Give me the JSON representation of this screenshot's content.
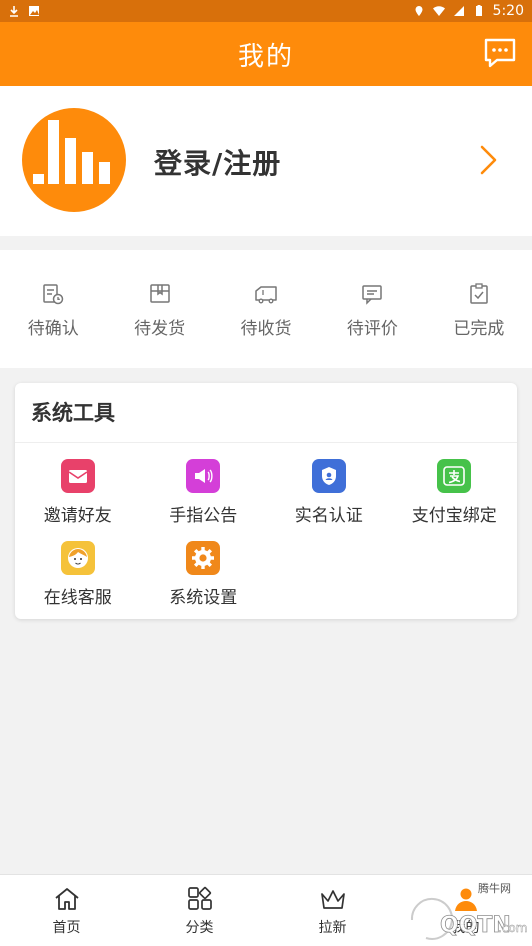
{
  "status_bar": {
    "time": "5:20"
  },
  "header": {
    "title": "我的"
  },
  "profile": {
    "login_label": "登录/注册"
  },
  "orders": [
    {
      "label": "待确认",
      "icon": "pending-confirm-icon"
    },
    {
      "label": "待发货",
      "icon": "pending-ship-icon"
    },
    {
      "label": "待收货",
      "icon": "pending-receive-icon"
    },
    {
      "label": "待评价",
      "icon": "pending-review-icon"
    },
    {
      "label": "已完成",
      "icon": "completed-icon"
    }
  ],
  "tools": {
    "title": "系统工具",
    "items": [
      {
        "label": "邀请好友",
        "icon": "invite-icon",
        "color": "#e8416a"
      },
      {
        "label": "手指公告",
        "icon": "announcement-icon",
        "color": "#d43fd8"
      },
      {
        "label": "实名认证",
        "icon": "verify-icon",
        "color": "#3f6fd8"
      },
      {
        "label": "支付宝绑定",
        "icon": "alipay-icon",
        "color": "#46c24a"
      },
      {
        "label": "在线客服",
        "icon": "customer-service-icon",
        "color": "#f5c23a"
      },
      {
        "label": "系统设置",
        "icon": "settings-icon",
        "color": "#f0881a"
      }
    ]
  },
  "bottom_nav": [
    {
      "label": "首页",
      "icon": "home-icon"
    },
    {
      "label": "分类",
      "icon": "category-icon"
    },
    {
      "label": "拉新",
      "icon": "crown-icon"
    },
    {
      "label": "我的",
      "icon": "user-icon"
    }
  ],
  "colors": {
    "accent": "#fe8b0b",
    "status_bar": "#d8700b"
  },
  "watermark": {
    "text": "腾牛网",
    "logo": "QQTN.com"
  }
}
